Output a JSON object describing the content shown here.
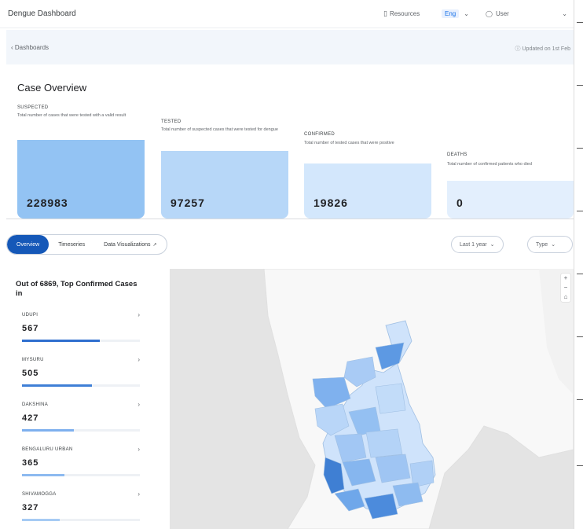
{
  "header": {
    "app_title": "Dengue Dashboard",
    "resources_label": "Resources",
    "lang_label": "Eng",
    "user_label": "User"
  },
  "subbar": {
    "back_label": "Dashboards",
    "updated_label": "Updated on 1st Feb"
  },
  "overview": {
    "title": "Case Overview",
    "cards": [
      {
        "label": "SUSPECTED",
        "desc": "Total number of cases that were tested with a valid result",
        "value": "228983",
        "color": "#93c3f3"
      },
      {
        "label": "TESTED",
        "desc": "Total number of suspected cases that were tested for dengue",
        "value": "97257",
        "color": "#b7d7f8"
      },
      {
        "label": "CONFIRMED",
        "desc": "Total number of tested cases that were positive",
        "value": "19826",
        "color": "#d3e7fc"
      },
      {
        "label": "DEATHS",
        "desc": "Total number of confirmed patients who died",
        "value": "0",
        "color": "#e3effd"
      }
    ]
  },
  "tabs": [
    {
      "label": "Overview"
    },
    {
      "label": "Timeseries"
    },
    {
      "label": "Data Visualizations"
    }
  ],
  "filters": {
    "period_label": "Last 1 year",
    "type_label": "Type"
  },
  "districts_panel": {
    "title": "Out of 6869, Top Confirmed Cases in",
    "items": [
      {
        "name": "UDUPI",
        "value": "567",
        "fraction": 0.66
      },
      {
        "name": "MYSURU",
        "value": "505",
        "fraction": 0.59
      },
      {
        "name": "DAKSHINA",
        "value": "427",
        "fraction": 0.44
      },
      {
        "name": "BENGALURU URBAN",
        "value": "365",
        "fraction": 0.36
      },
      {
        "name": "SHIVAMOGGA",
        "value": "327",
        "fraction": 0.32
      }
    ]
  },
  "map": {
    "zoom_in": "+",
    "zoom_out": "−",
    "reset": "⌂"
  },
  "colors": {
    "accent": "#1558b8",
    "map_dark": "#3a7ed6",
    "map_light": "#cfe3fb"
  }
}
